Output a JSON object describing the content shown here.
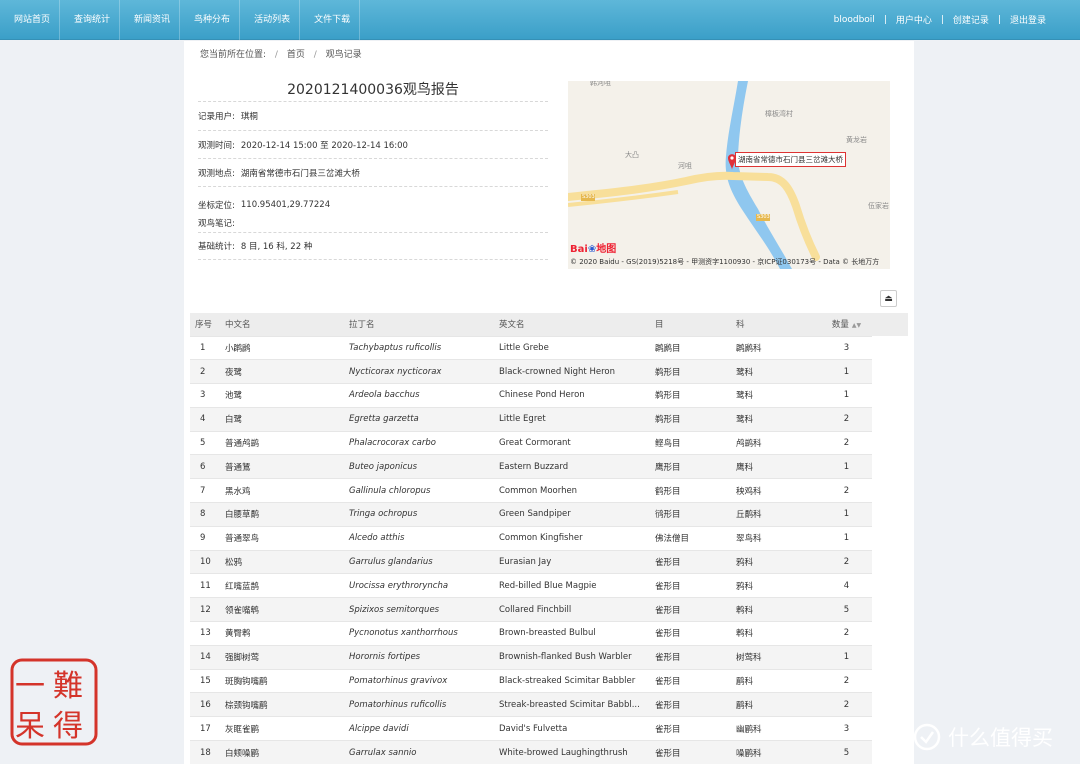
{
  "nav": {
    "left": [
      "网站首页",
      "查询统计",
      "新闻资讯",
      "鸟种分布",
      "活动列表",
      "文件下载"
    ],
    "user": "bloodboil",
    "user_center": "用户中心",
    "create_record": "创建记录",
    "logout": "退出登录"
  },
  "breadcrumb": {
    "prefix": "您当前所在位置:",
    "home": "首页",
    "current": "观鸟记录"
  },
  "report": {
    "title": "2020121400036观鸟报告",
    "fields": [
      {
        "label": "记录用户:",
        "value": "琪桐"
      },
      {
        "label": "观测时间:",
        "value": "2020-12-14 15:00 至 2020-12-14 16:00"
      },
      {
        "label": "观测地点:",
        "value": "湖南省常德市石门县三岔滩大桥"
      },
      {
        "label": "坐标定位:",
        "value": "110.95401,29.77224"
      },
      {
        "label": "观鸟笔记:",
        "value": ""
      },
      {
        "label": "基础统计:",
        "value": "8 目,  16 科,  22 种"
      }
    ]
  },
  "map": {
    "popup": "湖南省常德市石门县三岔滩大桥",
    "places": [
      "樟板湾村",
      "大凸",
      "河咀",
      "黄龙岩",
      "伍家岩"
    ],
    "road_labels": [
      "S303",
      "S303"
    ],
    "logo_text": "Bai",
    "logo_suffix": "地图",
    "credit": "© 2020 Baidu - GS(2019)5218号 - 甲测资字1100930 - 京ICP证030173号 - Data © 长地万方",
    "river_color": "#8fc7ef",
    "road_color": "#f8df9a",
    "marker_color": "#e0303a"
  },
  "table": {
    "headers": [
      "序号",
      "中文名",
      "拉丁名",
      "英文名",
      "目",
      "科",
      "数量"
    ],
    "rows": [
      [
        "1",
        "小䴙䴘",
        "Tachybaptus ruficollis",
        "Little Grebe",
        "䴙䴘目",
        "䴙䴘科",
        "3"
      ],
      [
        "2",
        "夜鹭",
        "Nycticorax nycticorax",
        "Black-crowned Night Heron",
        "鹈形目",
        "鹭科",
        "1"
      ],
      [
        "3",
        "池鹭",
        "Ardeola bacchus",
        "Chinese Pond Heron",
        "鹈形目",
        "鹭科",
        "1"
      ],
      [
        "4",
        "白鹭",
        "Egretta garzetta",
        "Little Egret",
        "鹈形目",
        "鹭科",
        "2"
      ],
      [
        "5",
        "普通鸬鹚",
        "Phalacrocorax carbo",
        "Great Cormorant",
        "鲣鸟目",
        "鸬鹚科",
        "2"
      ],
      [
        "6",
        "普通鵟",
        "Buteo japonicus",
        "Eastern Buzzard",
        "鹰形目",
        "鹰科",
        "1"
      ],
      [
        "7",
        "黑水鸡",
        "Gallinula chloropus",
        "Common Moorhen",
        "鹤形目",
        "秧鸡科",
        "2"
      ],
      [
        "8",
        "白腰草鹬",
        "Tringa ochropus",
        "Green Sandpiper",
        "鸻形目",
        "丘鹬科",
        "1"
      ],
      [
        "9",
        "普通翠鸟",
        "Alcedo atthis",
        "Common Kingfisher",
        "佛法僧目",
        "翠鸟科",
        "1"
      ],
      [
        "10",
        "松鸦",
        "Garrulus glandarius",
        "Eurasian Jay",
        "雀形目",
        "鸦科",
        "2"
      ],
      [
        "11",
        "红嘴蓝鹊",
        "Urocissa erythroryncha",
        "Red-billed Blue Magpie",
        "雀形目",
        "鸦科",
        "4"
      ],
      [
        "12",
        "领雀嘴鹎",
        "Spizixos semitorques",
        "Collared Finchbill",
        "雀形目",
        "鹎科",
        "5"
      ],
      [
        "13",
        "黄臀鹎",
        "Pycnonotus xanthorrhous",
        "Brown-breasted Bulbul",
        "雀形目",
        "鹎科",
        "2"
      ],
      [
        "14",
        "强脚树莺",
        "Horornis fortipes",
        "Brownish-flanked Bush Warbler",
        "雀形目",
        "树莺科",
        "1"
      ],
      [
        "15",
        "斑胸钩嘴鹛",
        "Pomatorhinus gravivox",
        "Black-streaked Scimitar Babbler",
        "雀形目",
        "鹛科",
        "2"
      ],
      [
        "16",
        "棕颈钩嘴鹛",
        "Pomatorhinus ruficollis",
        "Streak-breasted Scimitar Babbl...",
        "雀形目",
        "鹛科",
        "2"
      ],
      [
        "17",
        "灰眶雀鹛",
        "Alcippe davidi",
        "David's Fulvetta",
        "雀形目",
        "幽鹛科",
        "3"
      ],
      [
        "18",
        "白颊噪鹛",
        "Garrulax sannio",
        "White-browed Laughingthrush",
        "雀形目",
        "噪鹛科",
        "5"
      ]
    ]
  },
  "seal": {
    "chars": [
      "難",
      "得",
      "一",
      "呆"
    ],
    "color": "#d4342a"
  },
  "watermark": {
    "text": "什么值得买"
  }
}
